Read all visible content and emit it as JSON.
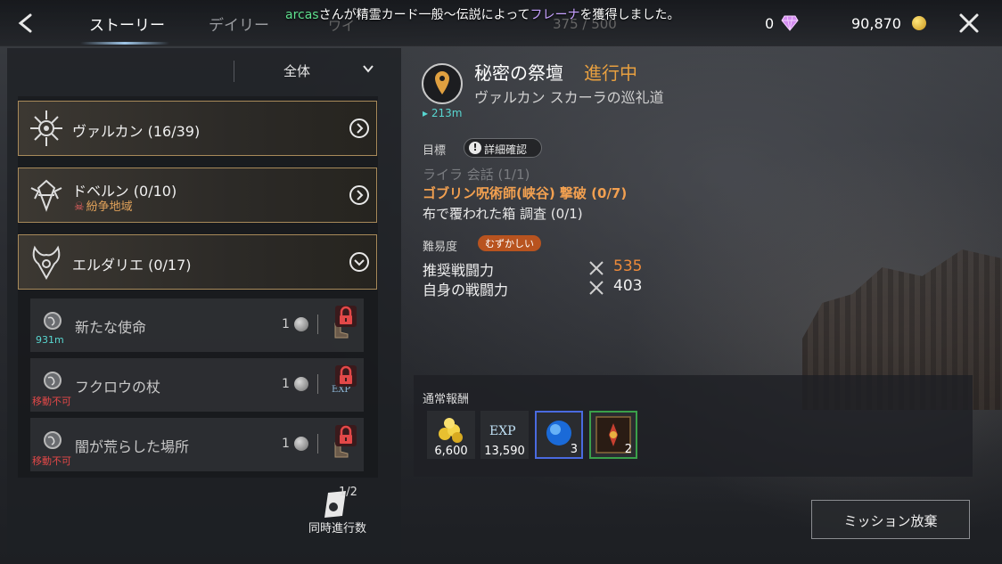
{
  "header": {
    "tabs": [
      {
        "label": "ストーリー",
        "active": true
      },
      {
        "label": "デイリー",
        "active": false
      }
    ],
    "ghost_tab": "ワイ",
    "ghost_count": "375 / 500",
    "notice": {
      "user": "arcas",
      "text1": "さんが精霊カード一般〜伝説によって",
      "item": "フレーナ",
      "text2": "を獲得しました。"
    },
    "gems": "0",
    "gold": "90,870"
  },
  "filter": {
    "label": "全体"
  },
  "regions": [
    {
      "label": "ヴァルカン (16/39)",
      "expanded": false
    },
    {
      "label": "ドベルン (0/10)",
      "sub": "紛争地域",
      "expanded": false
    },
    {
      "label": "エルダリエ (0/17)",
      "expanded": true
    }
  ],
  "quests": [
    {
      "title": "新たな使命",
      "count": "1",
      "distance": "931m",
      "blocked": ""
    },
    {
      "title": "フクロウの杖",
      "count": "1",
      "distance": "",
      "blocked": "移動不可",
      "exp": "EXP"
    },
    {
      "title": "闇が荒らした場所",
      "count": "1",
      "distance": "",
      "blocked": "移動不可"
    }
  ],
  "concurrent": {
    "count": "1/2",
    "label": "同時進行数"
  },
  "detail": {
    "name": "秘密の祭壇",
    "status": "進行中",
    "location": "ヴァルカン スカーラの巡礼道",
    "distance": "213m",
    "objective_label": "目標",
    "detail_button": "詳細確認",
    "objectives": [
      {
        "text": "ライラ 会話 (1/1)",
        "state": "done"
      },
      {
        "text": "ゴブリン呪術師(峡谷) 撃破 (0/7)",
        "state": "active"
      },
      {
        "text": "布で覆われた箱 調査 (0/1)",
        "state": "normal"
      }
    ],
    "difficulty_label": "難易度",
    "difficulty": "むずかしい",
    "recommended_label": "推奨戦闘力",
    "recommended_value": "535",
    "own_label": "自身の戦闘力",
    "own_value": "403"
  },
  "rewards": {
    "label": "通常報酬",
    "items": [
      {
        "name": "gold",
        "value": "6,600"
      },
      {
        "name": "exp",
        "value": "13,590",
        "icon_text": "EXP"
      },
      {
        "name": "blue-orb",
        "value": "3"
      },
      {
        "name": "card",
        "value": "2"
      }
    ]
  },
  "abandon_button": "ミッション放棄",
  "colors": {
    "accent_orange": "#e8a040",
    "teal": "#58d6d0",
    "gold_border": "#a88a5a",
    "red": "#e24848"
  }
}
